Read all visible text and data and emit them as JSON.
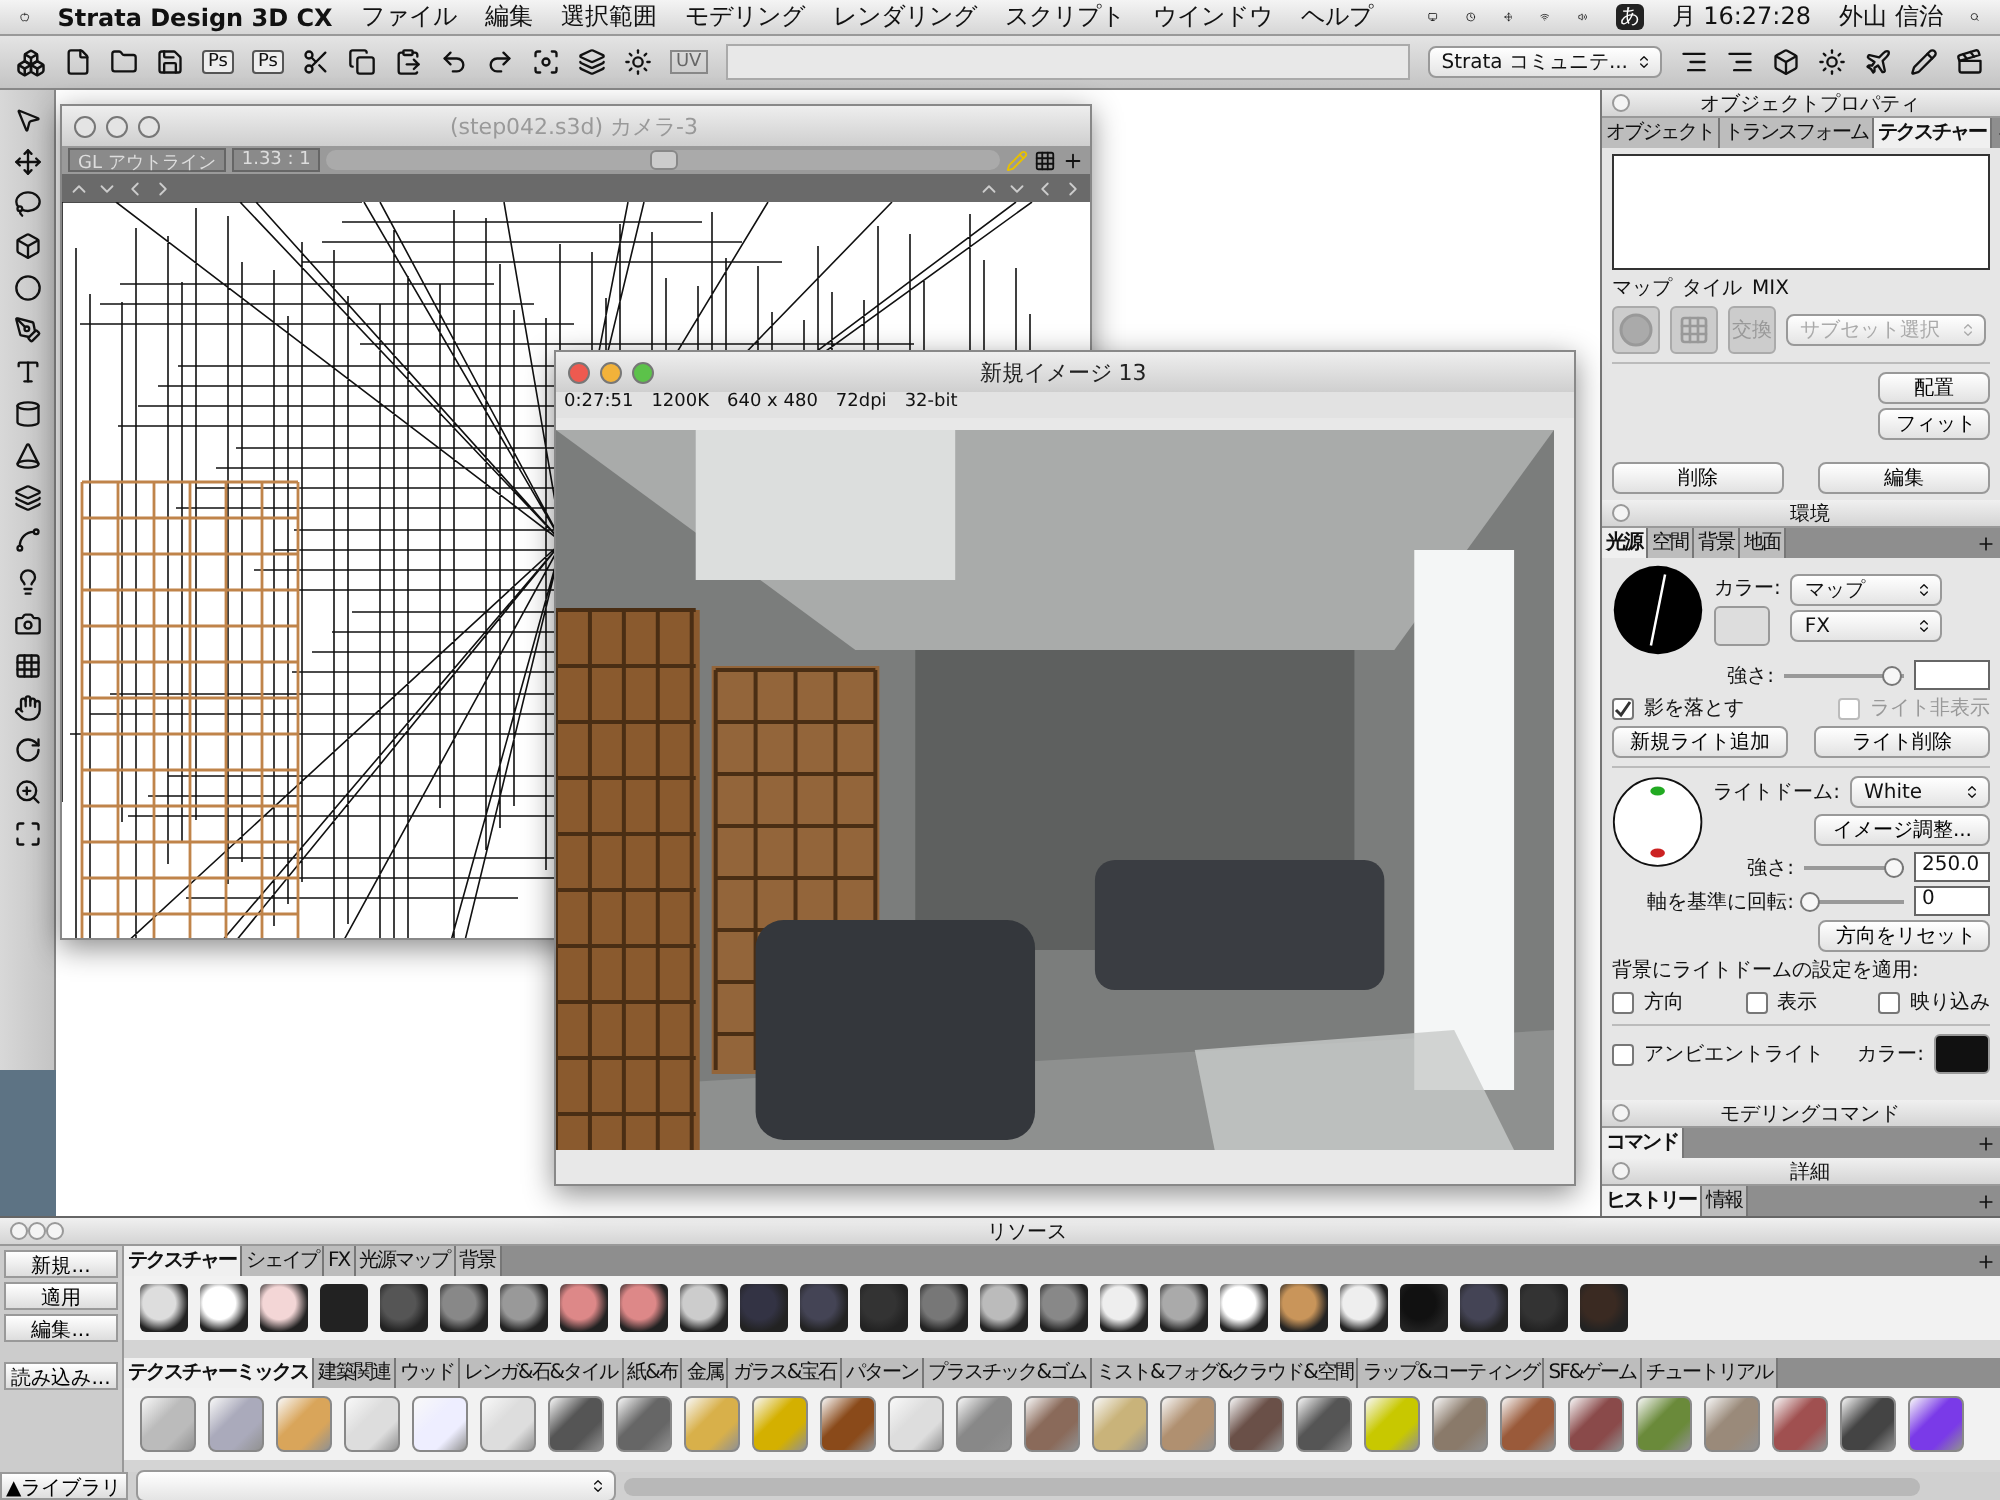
{
  "menubar": {
    "app_name": "Strata Design 3D CX",
    "menus": [
      "ファイル",
      "編集",
      "選択範囲",
      "モデリング",
      "レンダリング",
      "スクリプト",
      "ウインドウ",
      "ヘルプ"
    ],
    "input_mode": "あ",
    "clock": "月 16:27:28",
    "user": "外山 信治"
  },
  "toolbar": {
    "ps_buttons": [
      "Ps",
      "Ps"
    ],
    "uv_button": "UV",
    "community_menu": "Strata コミュニテ..."
  },
  "camera_window": {
    "title": "(step042.s3d) カメラ-3",
    "display_mode": "GL アウトライン",
    "aspect_ratio": "1.33 : 1",
    "zoom": {
      "level": 0.5
    }
  },
  "render_window": {
    "title": "新規イメージ 13",
    "info": [
      "0:27:51",
      "1200K",
      "640 x 480",
      "72dpi",
      "32-bit"
    ]
  },
  "object_properties": {
    "title": "オブジェクトプロパティ",
    "tabs": [
      {
        "label": "オブジェクト",
        "selected": false
      },
      {
        "label": "トランスフォーム",
        "selected": false
      },
      {
        "label": "テクスチャー",
        "selected": true
      }
    ],
    "map_labels": [
      "マップ",
      "タイル",
      "MIX"
    ],
    "swap_button": "交換",
    "subset_menu": "サブセット選択",
    "buttons": [
      "配置",
      "フィット"
    ],
    "bottom_buttons": [
      "削除",
      "編集"
    ]
  },
  "environment": {
    "title": "環境",
    "tabs": [
      {
        "label": "光源",
        "selected": true
      },
      {
        "label": "空間",
        "selected": false
      },
      {
        "label": "背景",
        "selected": false
      },
      {
        "label": "地面",
        "selected": false
      }
    ],
    "color_label": "カラー:",
    "map_menu": "マップ",
    "fx_menu": "FX",
    "strength": {
      "label": "強さ:",
      "level": 0.9
    },
    "light_checks": [
      {
        "label": "影を落とす",
        "checked": true,
        "disabled": false
      },
      {
        "label": "ライト非表示",
        "checked": false,
        "disabled": true
      }
    ],
    "light_buttons": [
      "新規ライト追加",
      "ライト削除"
    ],
    "dome": {
      "label": "ライトドーム:",
      "value": "White"
    },
    "image_adjust_button": "イメージ調整...",
    "dome_strength": {
      "label": "強さ:",
      "level": 0.9,
      "value": "250.0"
    },
    "rotation": {
      "label": "軸を基準に回転:",
      "level": 0.05,
      "value": "0"
    },
    "reset_button": "方向をリセット",
    "apply_label": "背景にライトドームの設定を適用:",
    "apply_options": [
      {
        "label": "方向",
        "checked": false
      },
      {
        "label": "表示",
        "checked": false
      },
      {
        "label": "映り込み",
        "checked": false
      }
    ],
    "ambient": {
      "label": "アンビエントライト",
      "checked": false
    },
    "ambient_color_label": "カラー:"
  },
  "modeling_commands": {
    "title": "モデリングコマンド",
    "tabs": [
      {
        "label": "コマンド",
        "selected": true
      }
    ]
  },
  "details": {
    "title": "詳細",
    "tabs": [
      {
        "label": "ヒストリー",
        "selected": true
      },
      {
        "label": "情報",
        "selected": false
      }
    ]
  },
  "resources": {
    "title": "リソース",
    "side_buttons": [
      "新規...",
      "適用",
      "編集..."
    ],
    "load_button": "読み込み...",
    "library_button": "▲ライブラリ",
    "tabs": [
      {
        "label": "テクスチャー",
        "selected": true
      },
      {
        "label": "シェイプ",
        "selected": false
      },
      {
        "label": "FX",
        "selected": false
      },
      {
        "label": "光源マップ",
        "selected": false
      },
      {
        "label": "背景",
        "selected": false
      }
    ],
    "library_tabs": [
      {
        "label": "テクスチャーミックス",
        "selected": true
      },
      {
        "label": "建築関連",
        "selected": false
      },
      {
        "label": "ウッド",
        "selected": false
      },
      {
        "label": "レンガ&石&タイル",
        "selected": false
      },
      {
        "label": "紙&布",
        "selected": false
      },
      {
        "label": "金属",
        "selected": false
      },
      {
        "label": "ガラス&宝石",
        "selected": false
      },
      {
        "label": "パターン",
        "selected": false
      },
      {
        "label": "プラスチック&ゴム",
        "selected": false
      },
      {
        "label": "ミスト&フォグ&クラウド&空間",
        "selected": false
      },
      {
        "label": "ラップ&コーティング",
        "selected": false
      },
      {
        "label": "SF&ゲーム",
        "selected": false
      },
      {
        "label": "チュートリアル",
        "selected": false
      }
    ]
  }
}
